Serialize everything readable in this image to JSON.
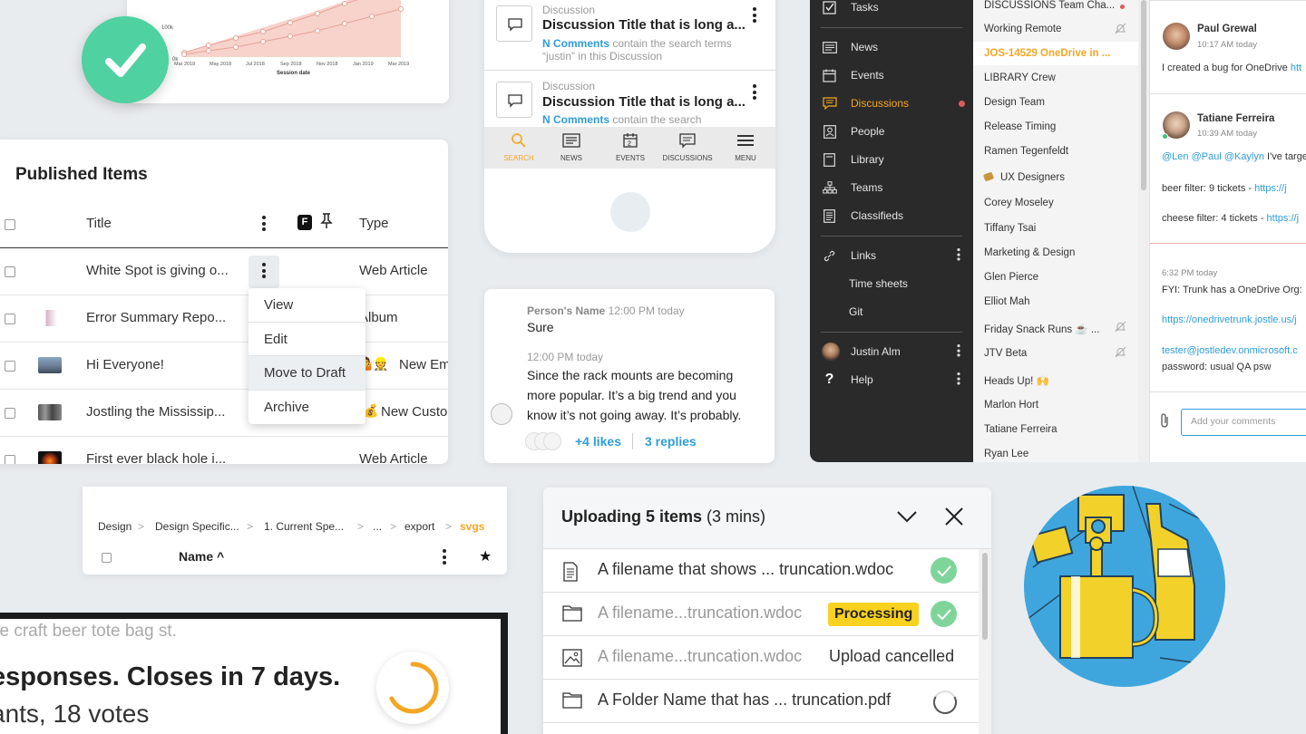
{
  "chart": {
    "y_ticks": [
      "100k",
      "0k"
    ],
    "x_ticks": [
      "Mar 2018",
      "May 2018",
      "Jul 2018",
      "Sep 2018",
      "Nov 2018",
      "Jan 2019",
      "Mar 2019"
    ],
    "x_label": "Session date",
    "colors": {
      "area": "#f6c8c0",
      "line": "#e7a79c"
    }
  },
  "published": {
    "title": "Published Items",
    "columns": {
      "title": "Title",
      "type": "Type",
      "flag": "F"
    },
    "rows": [
      {
        "title": "White Spot is giving o...",
        "type": "Web Article"
      },
      {
        "title": "Error Summary Repo...",
        "type": "Album"
      },
      {
        "title": "Hi Everyone!",
        "type": "New Em"
      },
      {
        "title": "Jostling the Mississip...",
        "type": "New Custo"
      },
      {
        "title": "First ever black hole i...",
        "type": "Web Article"
      }
    ],
    "emoji_row3": "🤷👷",
    "emoji_row4": "💰",
    "menu": [
      "View",
      "Edit",
      "Move to Draft",
      "Archive"
    ]
  },
  "mobile": {
    "discussions": [
      {
        "label": "Discussion",
        "title": "Discussion Title that is long a...",
        "count": "N Comments",
        "desc": " contain the search terms “justin” in this Discussion"
      },
      {
        "label": "Discussion",
        "title": "Discussion Title that is long a...",
        "count": "N Comments",
        "desc": " contain the search"
      }
    ],
    "tabs": [
      "SEARCH",
      "NEWS",
      "EVENTS",
      "DISCUSSIONS",
      "MENU"
    ],
    "accent": "#f5a623"
  },
  "chat": {
    "name": "Person's Name",
    "time1": "12:00 PM today",
    "msg1": "Sure",
    "time2": "12:00 PM today",
    "msg2_lines": [
      "Since the rack mounts are becoming",
      "more popular. It’s a big trend and you",
      "know it’s not going away. It’s probably."
    ],
    "likes": "+4 likes",
    "replies": "3 replies"
  },
  "nav": {
    "items": [
      "Tasks",
      "News",
      "Events",
      "Discussions",
      "People",
      "Library",
      "Teams",
      "Classifieds",
      "Links",
      "Time sheets",
      "Git",
      "Justin Alm",
      "Help"
    ],
    "active": "Discussions",
    "active_color": "#f5a623"
  },
  "channels": [
    "DISCUSSIONS Team Cha...",
    "Working Remote",
    "JOS-14529 OneDrive in ...",
    "LIBRARY Crew",
    "Design Team",
    "Release Timing",
    "Ramen Tegenfeldt",
    "UX Designers",
    "Corey Moseley",
    "Tiffany Tsai",
    "Marketing & Design",
    "Glen Pierce",
    "Elliot Mah",
    "Friday Snack Runs ☕ ...",
    "JTV Beta",
    "Heads Up! 🙌",
    "Marlon Hort",
    "Tatiane Ferreira",
    "Ryan Lee"
  ],
  "comments": {
    "c1": {
      "name": "Paul Grewal",
      "time": "10:17 AM today",
      "text": "I created a bug for OneDrive ",
      "link": "htt"
    },
    "c2": {
      "name": "Tatiane Ferreira",
      "time": "10:39 AM today",
      "mentions": "@Len @Paul @Kaylyn",
      "text": " I've target",
      "beer": "beer filter: 9 tickets - ",
      "beer_link": "https://j",
      "cheese": "cheese filter: 4 tickets - ",
      "cheese_link": "https://j"
    },
    "c3": {
      "time": "6:32 PM today",
      "text": "FYI: Trunk has a OneDrive Org:",
      "link": "https://onedrivetrunk.jostle.us/j",
      "email": "tester@jostledev.onmicrosoft.c",
      "pw": "password: usual QA psw"
    },
    "placeholder": "Add your comments"
  },
  "breadcrumb": {
    "crumbs": [
      "Design",
      "Design Specific...",
      "1. Current Spe...",
      "...",
      "export",
      "svgs"
    ],
    "column": "Name",
    "current_color": "#f5a623"
  },
  "poll": {
    "line1": "ve craft beer tote bag st.",
    "line2": "esponses. Closes in 7 days.",
    "line3": "ants, 18 votes"
  },
  "uploads": {
    "title": "Uploading 5 items",
    "duration": "(3 mins)",
    "rows": [
      {
        "name": "A filename that shows ... truncation.wdoc",
        "status": ""
      },
      {
        "name": "A filename...truncation.wdoc",
        "status": "Processing"
      },
      {
        "name": "A filename...truncation.wdoc",
        "status": "Upload cancelled"
      },
      {
        "name": "A Folder Name that has ... truncation.pdf",
        "status": ""
      }
    ],
    "success_color": "#7fd49a",
    "badge_color": "#f9d11f"
  }
}
